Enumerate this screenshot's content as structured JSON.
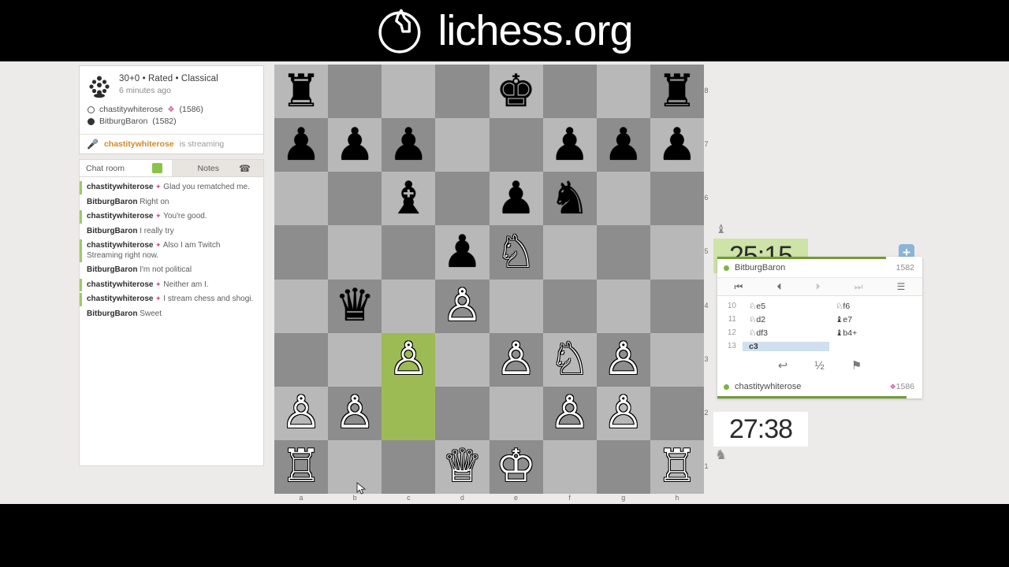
{
  "banner": {
    "title": "lichess.org",
    "logo_icon": "lichess-knight-logo"
  },
  "game_meta": {
    "icon": "classical-clock-icon",
    "line1": "30+0 • Rated • Classical",
    "line2": "6 minutes ago",
    "white_player": {
      "name": "chastitywhiterose",
      "rating": "(1586)",
      "stream_icon": "twitch-stream-icon"
    },
    "black_player": {
      "name": "BitburgBaron",
      "rating": "(1582)"
    }
  },
  "streaming_bar": {
    "mic_icon": "microphone-icon",
    "streamer": "chastitywhiterose",
    "text": "is streaming"
  },
  "chat": {
    "tab_chat": "Chat room",
    "tab_notes": "Notes",
    "phone_icon": "phone-icon",
    "status_chip": "online-chip",
    "messages": [
      {
        "author": "chastitywhiterose",
        "stream": true,
        "text": "Glad you rematched me."
      },
      {
        "author": "BitburgBaron",
        "stream": false,
        "text": "Right on"
      },
      {
        "author": "chastitywhiterose",
        "stream": true,
        "text": "You're good."
      },
      {
        "author": "BitburgBaron",
        "stream": false,
        "text": "I really try"
      },
      {
        "author": "chastitywhiterose",
        "stream": true,
        "text": "Also I am Twitch Streaming right now."
      },
      {
        "author": "BitburgBaron",
        "stream": false,
        "text": "I'm not political"
      },
      {
        "author": "chastitywhiterose",
        "stream": true,
        "text": "Neither am I."
      },
      {
        "author": "chastitywhiterose",
        "stream": true,
        "text": "I stream chess and shogi."
      },
      {
        "author": "BitburgBaron",
        "stream": false,
        "text": "Sweet"
      }
    ]
  },
  "board": {
    "files": [
      "a",
      "b",
      "c",
      "d",
      "e",
      "f",
      "g",
      "h"
    ],
    "ranks": [
      "8",
      "7",
      "6",
      "5",
      "4",
      "3",
      "2",
      "1"
    ],
    "light_color": "#b8b8b8",
    "dark_color": "#8d8d8d",
    "highlight_color": "#9dbb54",
    "last_move": [
      "c2",
      "c3"
    ],
    "pieces": [
      {
        "sq": "a8",
        "glyph": "♜",
        "color": "b",
        "name": "black-rook"
      },
      {
        "sq": "e8",
        "glyph": "♚",
        "color": "b",
        "name": "black-king"
      },
      {
        "sq": "h8",
        "glyph": "♜",
        "color": "b",
        "name": "black-rook"
      },
      {
        "sq": "a7",
        "glyph": "♟",
        "color": "b",
        "name": "black-pawn"
      },
      {
        "sq": "b7",
        "glyph": "♟",
        "color": "b",
        "name": "black-pawn"
      },
      {
        "sq": "c7",
        "glyph": "♟",
        "color": "b",
        "name": "black-pawn"
      },
      {
        "sq": "f7",
        "glyph": "♟",
        "color": "b",
        "name": "black-pawn"
      },
      {
        "sq": "g7",
        "glyph": "♟",
        "color": "b",
        "name": "black-pawn"
      },
      {
        "sq": "h7",
        "glyph": "♟",
        "color": "b",
        "name": "black-pawn"
      },
      {
        "sq": "c6",
        "glyph": "♝",
        "color": "b",
        "name": "black-bishop"
      },
      {
        "sq": "e6",
        "glyph": "♟",
        "color": "b",
        "name": "black-pawn"
      },
      {
        "sq": "f6",
        "glyph": "♞",
        "color": "b",
        "name": "black-knight"
      },
      {
        "sq": "d5",
        "glyph": "♟",
        "color": "b",
        "name": "black-pawn"
      },
      {
        "sq": "e5",
        "glyph": "♘",
        "color": "w",
        "name": "white-knight"
      },
      {
        "sq": "b4",
        "glyph": "♛",
        "color": "b",
        "name": "black-queen"
      },
      {
        "sq": "d4",
        "glyph": "♙",
        "color": "w",
        "name": "white-pawn"
      },
      {
        "sq": "c3",
        "glyph": "♙",
        "color": "w",
        "name": "white-pawn"
      },
      {
        "sq": "e3",
        "glyph": "♙",
        "color": "w",
        "name": "white-pawn"
      },
      {
        "sq": "f3",
        "glyph": "♘",
        "color": "w",
        "name": "white-knight"
      },
      {
        "sq": "g3",
        "glyph": "♙",
        "color": "w",
        "name": "white-pawn"
      },
      {
        "sq": "a2",
        "glyph": "♙",
        "color": "w",
        "name": "white-pawn"
      },
      {
        "sq": "b2",
        "glyph": "♙",
        "color": "w",
        "name": "white-pawn"
      },
      {
        "sq": "f2",
        "glyph": "♙",
        "color": "w",
        "name": "white-pawn"
      },
      {
        "sq": "g2",
        "glyph": "♙",
        "color": "w",
        "name": "white-pawn"
      },
      {
        "sq": "a1",
        "glyph": "♖",
        "color": "w",
        "name": "white-rook"
      },
      {
        "sq": "d1",
        "glyph": "♕",
        "color": "w",
        "name": "white-queen"
      },
      {
        "sq": "e1",
        "glyph": "♔",
        "color": "w",
        "name": "white-king"
      },
      {
        "sq": "h1",
        "glyph": "♖",
        "color": "w",
        "name": "white-rook"
      }
    ]
  },
  "clocks": {
    "top": {
      "time": "25:15",
      "active": true,
      "bg": "#cde3a8"
    },
    "bottom": {
      "time": "27:38",
      "active": false,
      "bg": "#ffffff"
    },
    "captured_top_icon": "captured-bishop-icon",
    "captured_bottom_icon": "captured-knight-icon"
  },
  "panel": {
    "plus_button": "+",
    "top_player": {
      "name": "BitburgBaron",
      "rating": "1582",
      "status_dot": "online-dot"
    },
    "bottom_player": {
      "name": "chastitywhiterose",
      "rating": "1586",
      "status_dot": "online-dot",
      "stream_icon": "twitch-stream-icon"
    },
    "nav": [
      {
        "icon": "⏮",
        "name": "first-move-button",
        "dim": false
      },
      {
        "icon": "⏴",
        "name": "previous-move-button",
        "dim": false
      },
      {
        "icon": "⏵",
        "name": "next-move-button",
        "dim": true
      },
      {
        "icon": "⏭",
        "name": "last-move-button",
        "dim": true
      },
      {
        "icon": "☰",
        "name": "menu-button",
        "dim": false
      }
    ],
    "moves": [
      {
        "num": "10",
        "white": "♘e5",
        "black": "♘f6",
        "selected": false
      },
      {
        "num": "11",
        "white": "♘d2",
        "black": "♝e7",
        "selected": false
      },
      {
        "num": "12",
        "white": "♘df3",
        "black": "♝b4+",
        "selected": false
      },
      {
        "num": "13",
        "white": "c3",
        "black": "",
        "selected": true
      }
    ],
    "actions": [
      {
        "icon": "↩",
        "name": "takeback-button",
        "label": "takeback"
      },
      {
        "icon": "½",
        "name": "offer-draw-button",
        "label": "draw"
      },
      {
        "icon": "⚑",
        "name": "resign-button",
        "label": "resign"
      }
    ]
  }
}
